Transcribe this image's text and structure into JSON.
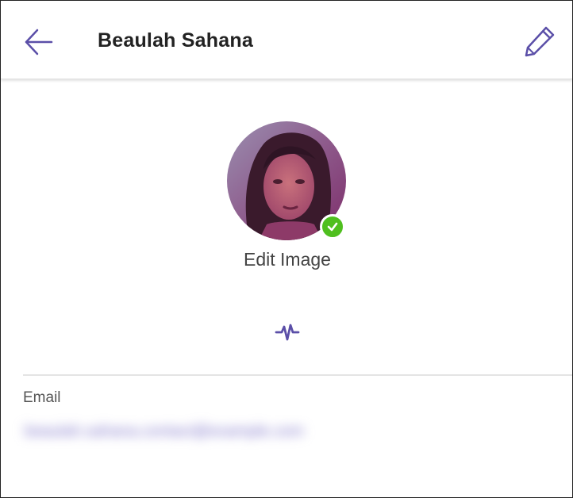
{
  "header": {
    "title": "Beaulah Sahana",
    "back_icon": "arrow-left-icon",
    "edit_icon": "pencil-icon"
  },
  "profile": {
    "edit_image_label": "Edit Image",
    "verified_icon": "check-icon",
    "activity_icon": "pulse-icon"
  },
  "email": {
    "label": "Email",
    "value": "beaulah.sahana.contact@example.com"
  },
  "colors": {
    "accent": "#5b4fa8",
    "verified": "#4fbf1f"
  }
}
